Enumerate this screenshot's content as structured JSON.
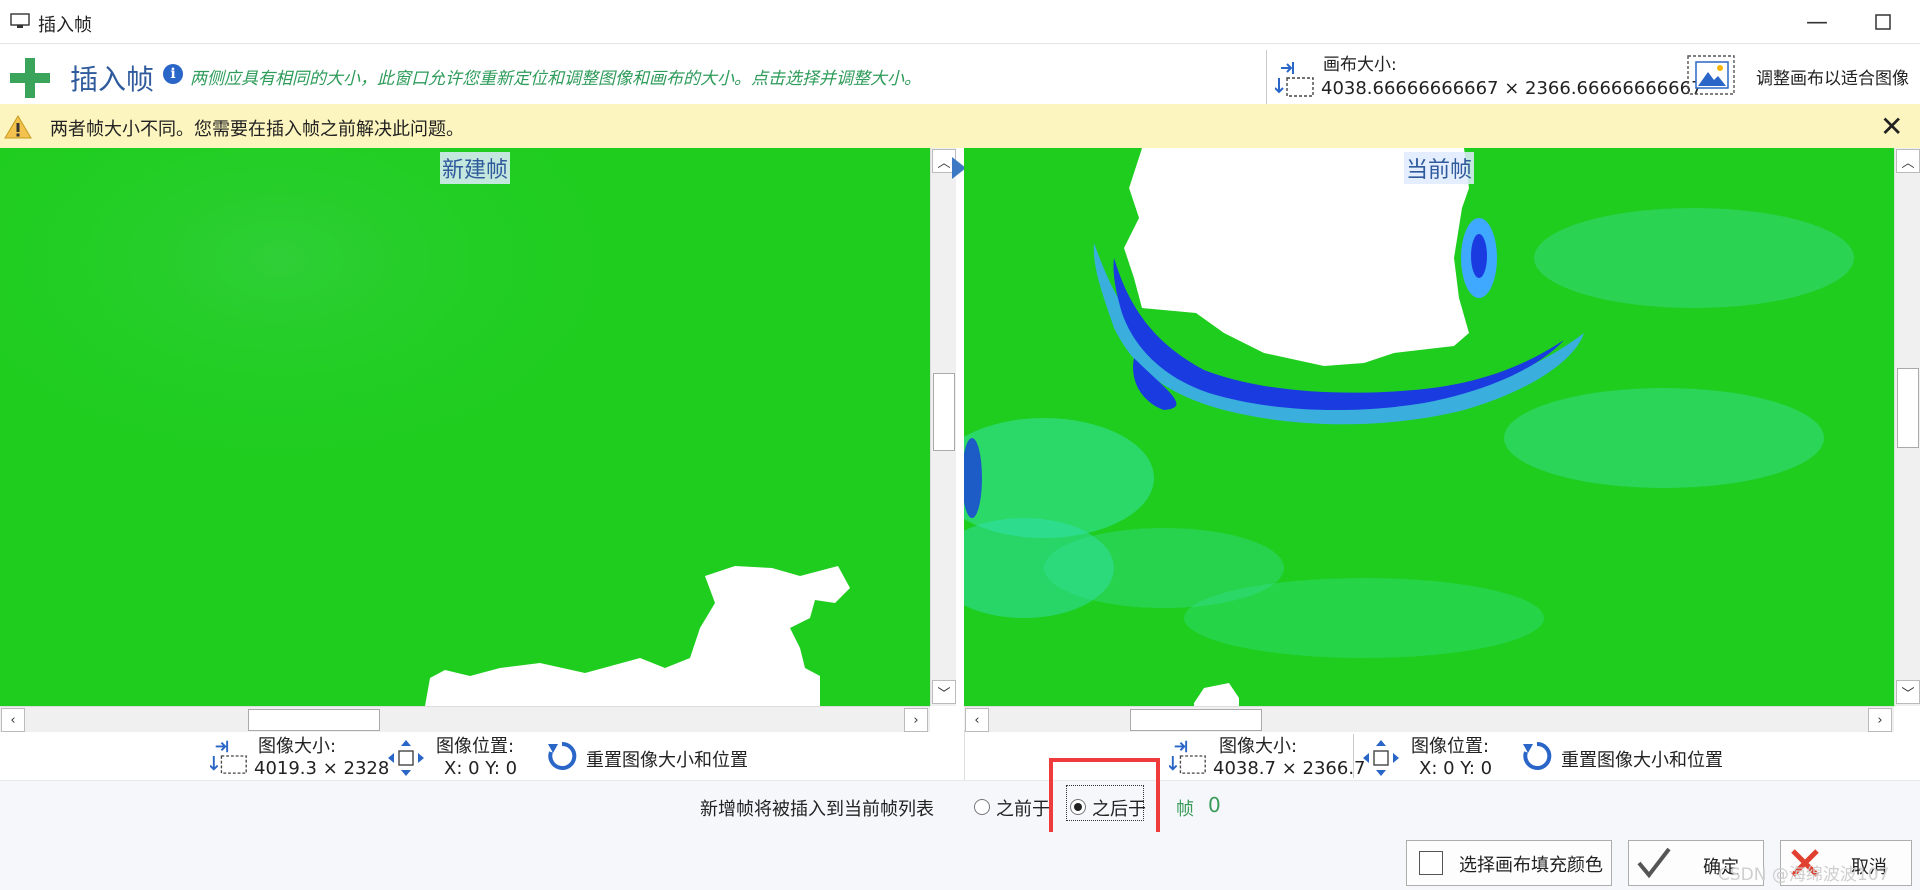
{
  "window": {
    "title": "插入帧",
    "controls": [
      "minimize-icon",
      "maximize-icon",
      "close-icon"
    ]
  },
  "header": {
    "title": "插入帧",
    "hint": "两侧应具有相同的大小，此窗口允许您重新定位和调整图像和画布的大小。点击选择并调整大小。",
    "canvas_size_label": "画布大小:",
    "canvas_size_value": "4038.66666666667 × 2366.66666666667",
    "fit_canvas_label": "调整画布以适合图像"
  },
  "warning": {
    "text": "两者帧大小不同。您需要在插入帧之前解决此问题。"
  },
  "left_pane": {
    "label": "新建帧",
    "image_size_label": "图像大小:",
    "image_size_value": "4019.3 × 2328",
    "image_position_label": "图像位置:",
    "image_position_value": "X: 0  Y: 0",
    "reset_label": "重置图像大小和位置"
  },
  "right_pane": {
    "label": "当前帧",
    "image_size_label": "图像大小:",
    "image_size_value": "4038.7 × 2366.7",
    "image_position_label": "图像位置:",
    "image_position_value": "X: 0  Y: 0",
    "reset_label": "重置图像大小和位置"
  },
  "insert": {
    "label": "新增帧将被插入到当前帧列表",
    "option_before": "之前于",
    "option_after": "之后于",
    "selected": "之后于",
    "frame_label": "帧",
    "frame_value": "0"
  },
  "footer": {
    "fill_color_label": "选择画布填充颜色",
    "ok_label": "确定",
    "cancel_label": "取消",
    "watermark": "CSDN @海绵波波107"
  },
  "colors": {
    "map_green": "#1fcd1f",
    "accent_blue": "#2f5b9c",
    "warning_bg": "#fcf5bf",
    "highlight_red": "#ef3b3b"
  }
}
